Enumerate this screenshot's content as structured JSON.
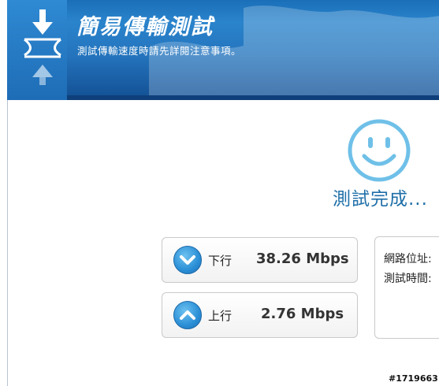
{
  "header": {
    "title": "簡易傳輸測試",
    "subtitle": "測試傳輸速度時請先詳閱注意事項。"
  },
  "status": {
    "icon": "smiley-icon",
    "text": "測試完成..."
  },
  "results": {
    "download": {
      "label": "下行",
      "value": "38.26 Mbps",
      "icon": "down-arrow-icon"
    },
    "upload": {
      "label": "上行",
      "value": "2.76 Mbps",
      "icon": "up-arrow-icon"
    }
  },
  "info": {
    "ip_label": "網路位址:",
    "time_label": "測試時間:"
  },
  "watermark": "#1719663",
  "colors": {
    "banner_blue": "#2474bd",
    "smiley_blue": "#6fc0e8",
    "status_text": "#1f6fa8"
  }
}
